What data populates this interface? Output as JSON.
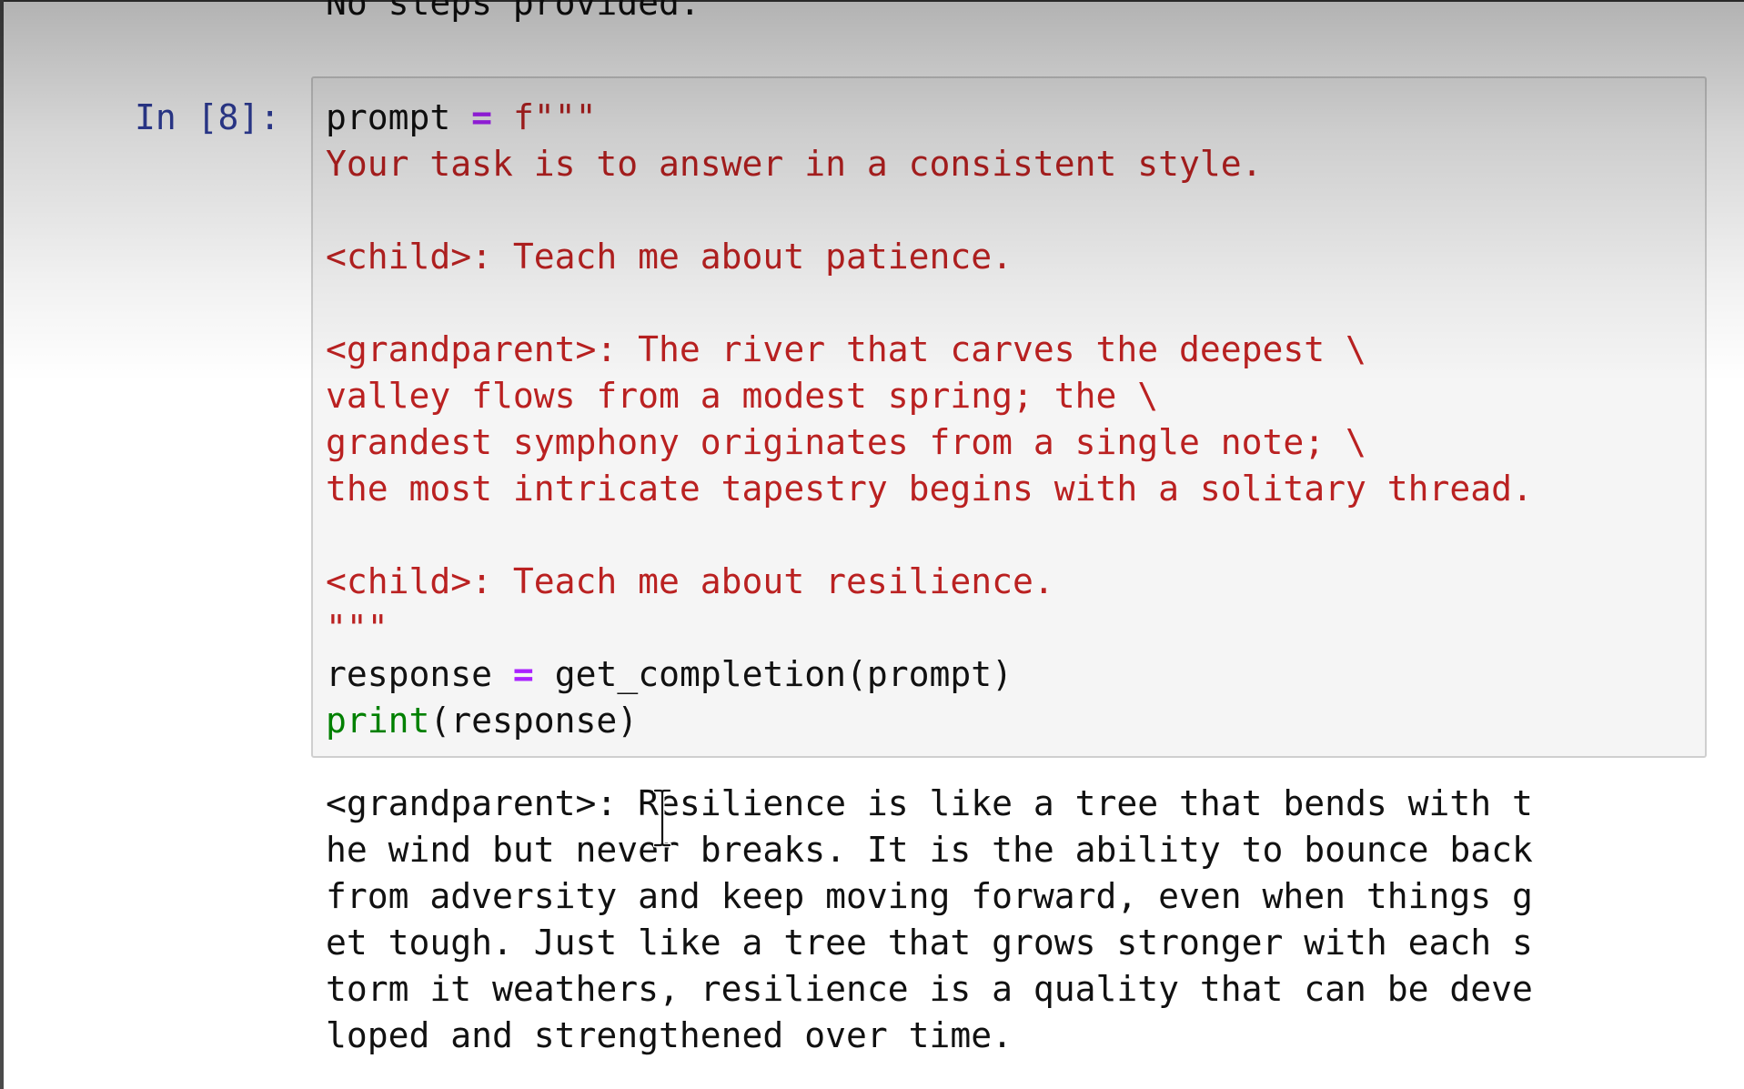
{
  "previous_output": {
    "text": "No steps provided."
  },
  "cell": {
    "prompt_label": "In [8]:",
    "code": {
      "line1": {
        "var": "prompt",
        "op": "=",
        "str": "f\"\"\""
      },
      "string_lines": [
        "Your task is to answer in a consistent style.",
        "",
        "<child>: Teach me about patience.",
        "",
        "<grandparent>: The river that carves the deepest \\",
        "valley flows from a modest spring; the \\",
        "grandest symphony originates from a single note; \\",
        "the most intricate tapestry begins with a solitary thread.",
        "",
        "<child>: Teach me about resilience.",
        "\"\"\""
      ],
      "line_response": {
        "var": "response",
        "op": "=",
        "call": "get_completion(prompt)"
      },
      "line_print": {
        "builtin": "print",
        "args": "(response)"
      }
    },
    "output_lines": [
      "<grandparent>: Resilience is like a tree that bends with t",
      "he wind but never breaks. It is the ability to bounce back",
      "from adversity and keep moving forward, even when things g",
      "et tough. Just like a tree that grows stronger with each s",
      "torm it weathers, resilience is a quality that can be deve",
      "loped and strengthened over time."
    ]
  },
  "icons": {
    "cursor": "text-cursor-icon"
  },
  "colors": {
    "prompt_label": "#303f9f",
    "string": "#ba2121",
    "operator": "#aa22ff",
    "builtin": "#008000",
    "input_background": "#f5f5f5"
  }
}
